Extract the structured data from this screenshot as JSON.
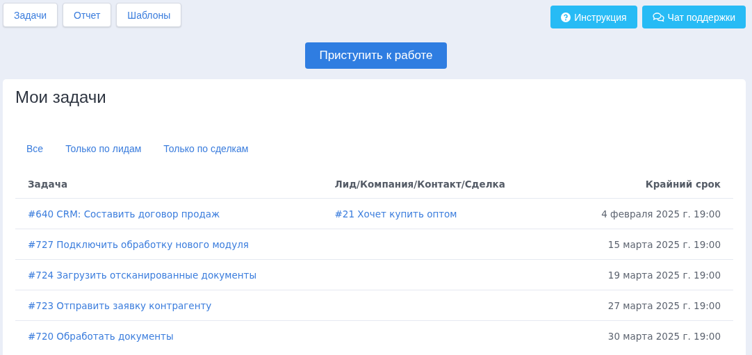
{
  "nav_buttons": [
    "Задачи",
    "Отчет",
    "Шаблоны"
  ],
  "help_buttons": [
    {
      "kind": "help",
      "label": "Инструкция"
    },
    {
      "kind": "chat",
      "label": "Чат поддержки"
    }
  ],
  "start_button": "Приступить к работе",
  "card": {
    "title": "Мои задачи",
    "filters": [
      "Все",
      "Только по лидам",
      "Только по сделкам"
    ],
    "table": {
      "columns": [
        "Задача",
        "Лид/Компания/Контакт/Сделка",
        "Крайний срок"
      ],
      "rows": [
        {
          "task": "#640 CRM: Составить договор продаж",
          "related": "#21 Хочет купить оптом",
          "deadline": "4 февраля 2025 г. 19:00"
        },
        {
          "task": "#727 Подключить обработку нового модуля",
          "deadline": "15 марта 2025 г. 19:00"
        },
        {
          "task": "#724 Загрузить отсканированные документы",
          "deadline": "19 марта 2025 г. 19:00"
        },
        {
          "task": "#723 Отправить заявку контрагенту",
          "deadline": "27 марта 2025 г. 19:00"
        },
        {
          "task": "#720 Обработать документы",
          "deadline": "30 марта 2025 г. 19:00"
        }
      ]
    }
  }
}
